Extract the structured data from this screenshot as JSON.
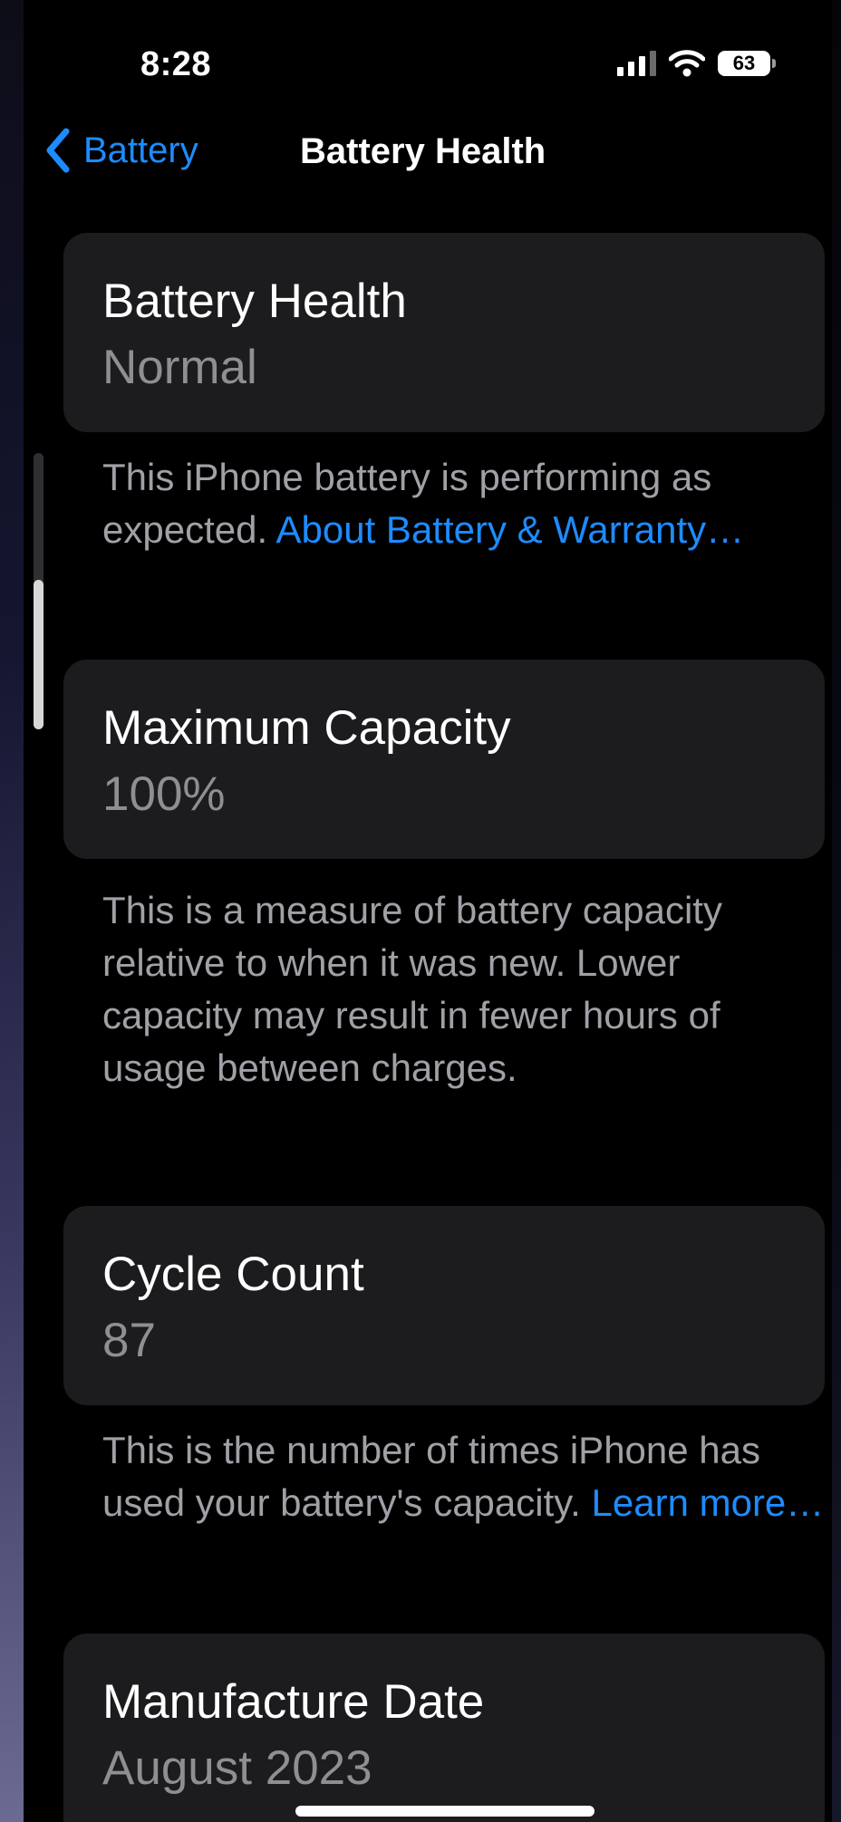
{
  "status_bar": {
    "time": "8:28",
    "battery_percent": "63"
  },
  "nav": {
    "back_label": "Battery",
    "title": "Battery Health"
  },
  "cards": [
    {
      "title": "Battery Health",
      "value": "Normal"
    },
    {
      "title": "Maximum Capacity",
      "value": "100%"
    },
    {
      "title": "Cycle Count",
      "value": "87"
    },
    {
      "title": "Manufacture Date",
      "value": "August 2023"
    }
  ],
  "notes": {
    "health_text": "This iPhone battery is performing as expected.",
    "health_link": "About Battery & Warranty…",
    "capacity_text": "This is a measure of battery capacity relative to when it was new. Lower capacity may result in fewer hours of usage between charges.",
    "cycle_text": "This is the number of times iPhone has used your battery's capacity.",
    "cycle_link": "Learn more…"
  },
  "colors": {
    "accent": "#1d8cff",
    "card_bg": "#1c1c1e",
    "background": "#000000",
    "secondary_text": "#8e8e93"
  },
  "icons": [
    "cellular-signal-icon",
    "wifi-icon",
    "battery-icon",
    "chevron-left-icon"
  ]
}
